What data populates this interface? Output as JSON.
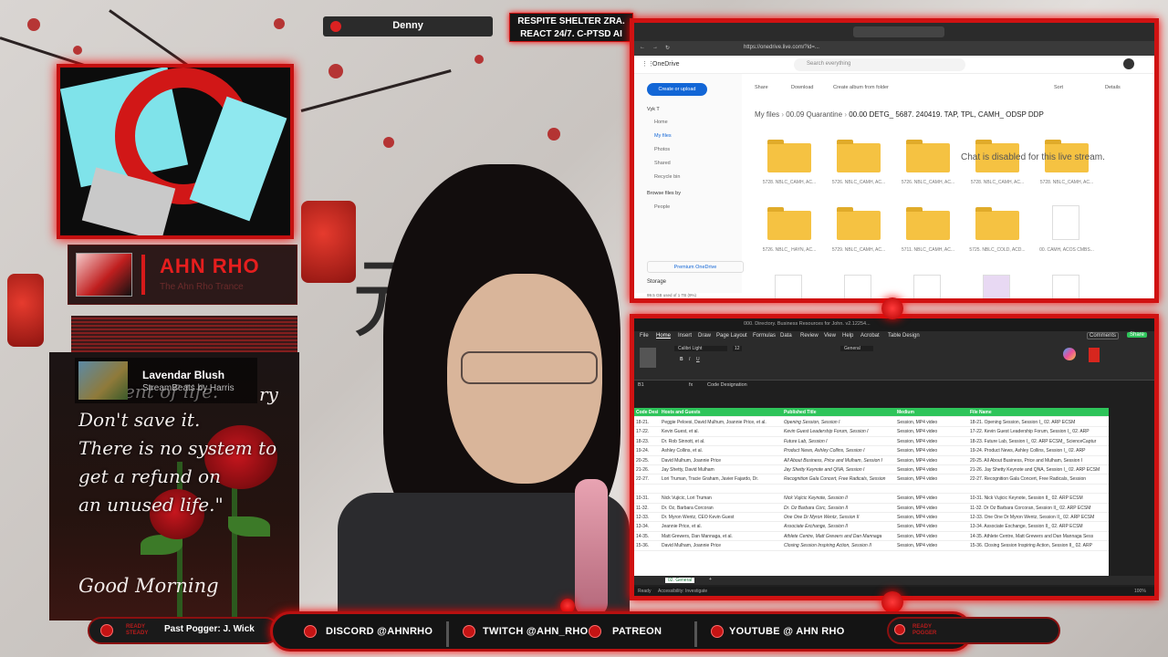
{
  "overlay": {
    "chatter_name": "Denny",
    "banner_text": "RESPITE SHELTER ZRA.\nREACT 24/7. C-PTSD AI"
  },
  "artist": {
    "name": "AHN RHO",
    "subtitle": "The Ahn Rho Trance"
  },
  "now_playing": {
    "title": "Lavendar Blush",
    "artist": "StreamBeats by Harris"
  },
  "quote": {
    "partial": "ry",
    "lines": "moment of life.\nDon't save it.\nThere is no system to\nget a refund on\nan unused life.\"",
    "greeting": "Good Morning"
  },
  "browser": {
    "address": "https://onedrive.live.com/?id=...",
    "app_name": "OneDrive",
    "search_placeholder": "Search everything",
    "create_button": "Create or upload",
    "user": "Vyk T",
    "nav": [
      "Home",
      "My files",
      "Photos",
      "Shared",
      "Recycle bin"
    ],
    "browse_heading": "Browse files by",
    "browse_people": "People",
    "premium": "Premium OneDrive",
    "storage": "Storage",
    "storage_detail": "99.5 GB used of 1 TB (9%)",
    "toolbar": [
      "Share",
      "Download",
      "Create album from folder",
      "Sort",
      "Details"
    ],
    "breadcrumb": [
      "My files",
      "00.09 Quarantine",
      "00.00 DETG_ 5687. 240419. TAP, TPL, CAMH_ ODSP DDP"
    ],
    "folders_row1": [
      "5728. NBLC_CAMH, AC...",
      "5726. NBLC_CAMH, AC...",
      "5726. NBLC_CAMH, AC...",
      "5728. NBLC_CAMH, AC...",
      "5728. NBLC_CAMH, AC..."
    ],
    "folders_row2": [
      "5726. NBLC_ HAYN, AC...",
      "5729. NBLC_CAMH, AC...",
      "5711. NBLC_CAMH, AC...",
      "5725. NBLC_COLD, ACD...",
      "00. CAMH, ACOS CMBS..."
    ],
    "overlay_notice": "Chat is disabled for this live stream."
  },
  "excel": {
    "title": "000. Directory. Business Resources for John. v2.12254...",
    "menu": [
      "File",
      "Home",
      "Insert",
      "Draw",
      "Page Layout",
      "Formulas",
      "Data",
      "Review",
      "View",
      "Help",
      "Acrobat",
      "Table Design"
    ],
    "comments_label": "Comments",
    "share_label": "Share",
    "font_name": "Calibri Light",
    "font_size": "12",
    "number_format": "General",
    "cell_ref": "B1",
    "formula": "Code Designation",
    "headers": [
      "Code Desi",
      "Hosts and Guests",
      "Published Title",
      "Medium",
      "File Name"
    ],
    "rows": [
      [
        "18-21.",
        "Peggie Peloesi, David Mulhum, Joannie Price, et al.",
        "Opening Session, Session I",
        "Session, MP4 video",
        "18-21. Opening Session, Session I_ 02. ARP ECSM"
      ],
      [
        "17-22.",
        "Kevin Guest, et al.",
        "Kevin Guest Leadership Forum, Session I",
        "Session, MP4 video",
        "17-22. Kevin Guest Leadership Forum, Session I_ 02. ARP"
      ],
      [
        "18-23.",
        "Dr. Rob Sinnott, et al.",
        "Future Lab, Session I",
        "Session, MP4 video",
        "18-23. Future Lab, Session I_ 02. ARP ECSM_ ScienceCaptur"
      ],
      [
        "19-24.",
        "Ashley Collins, et al.",
        "Product News, Ashley Collins, Session I",
        "Session, MP4 video",
        "19-24. Product News, Ashley Collins, Session I_ 02. ARP"
      ],
      [
        "20-25.",
        "David Mulhum, Joannie Price",
        "All About Business, Price and Mulham, Session I",
        "Session, MP4 video",
        "20-25. All About Business, Price and Mulham, Session I"
      ],
      [
        "21-26.",
        "Jay Shetty, David Mulham",
        "Jay Shetty Keynote and QNA, Session I",
        "Session, MP4 video",
        "21-26. Jay Shetty Keynote and QNA, Session I_ 02. ARP ECSM"
      ],
      [
        "22-27.",
        "Lori Truman, Tracie Graham, Javier Fajardo, Dr.",
        "Recognition Gala Concert, Free Radicals, Session",
        "Session, MP4 video",
        "22-27. Recognition Gala Concert, Free Radicals, Session"
      ],
      [
        "",
        "",
        "",
        "",
        ""
      ],
      [
        "10-31.",
        "Nick Vujicic, Lori Truman",
        "Nick Vujicic Keynote, Session II",
        "Session, MP4 video",
        "10-31. Nick Vujicic Keynote, Session II_ 02. ARP ECSM"
      ],
      [
        "11-32.",
        "Dr. Oz, Barbara Corcoran",
        "Dr. Oz Barbara Corc, Session II",
        "Session, MP4 video",
        "11-32. Dr Oz Barbara Corcoran, Session II_ 02. ARP ECSM"
      ],
      [
        "12-33.",
        "Dr. Myron Wentz, CEO Kevin Guest",
        "One One Dr Myron Wentz, Session II",
        "Session, MP4 video",
        "12-33. One One Dr Myron Wentz, Session II_ 02. ARP ECSM"
      ],
      [
        "13-34.",
        "Jeannie Price, et al.",
        "Associate Exchange, Session II",
        "Session, MP4 video",
        "13-34. Associate Exchange, Session II_ 02. ARP ECSM"
      ],
      [
        "14-35.",
        "Matt Grewers, Dan Mannaga, et al.",
        "Athlete Centre, Matt Grewers and Dan Mannaga",
        "Session, MP4 video",
        "14-35. Athlete Centre, Matt Grewers and Dan Mannaga Sess"
      ],
      [
        "15-36.",
        "David Mulham, Joannie Price",
        "Closing Session Inspiring Action, Session II",
        "Session, MP4 video",
        "15-36. Closing Session Inspiring Action, Session II_ 02. ARP"
      ]
    ],
    "sheet_tab": "02. General",
    "status": "Ready",
    "accessibility": "Accessibility: Investigate",
    "zoom": "100%"
  },
  "bottom_bar": {
    "left_label": "READY\nSTEADY",
    "left_text": "Past Pogger: J. Wick",
    "socials": [
      "DISCORD @AHNRHO",
      "TWITCH @AHN_RHO",
      "PATREON",
      "YOUTUBE @ AHN RHO"
    ],
    "right_label": "READY\nPOGGER"
  },
  "colors": {
    "accent": "#d01212",
    "glow": "#ff2020",
    "excel_green": "#2ec45a",
    "onedrive_blue": "#1266d6",
    "folder": "#f5c242"
  }
}
